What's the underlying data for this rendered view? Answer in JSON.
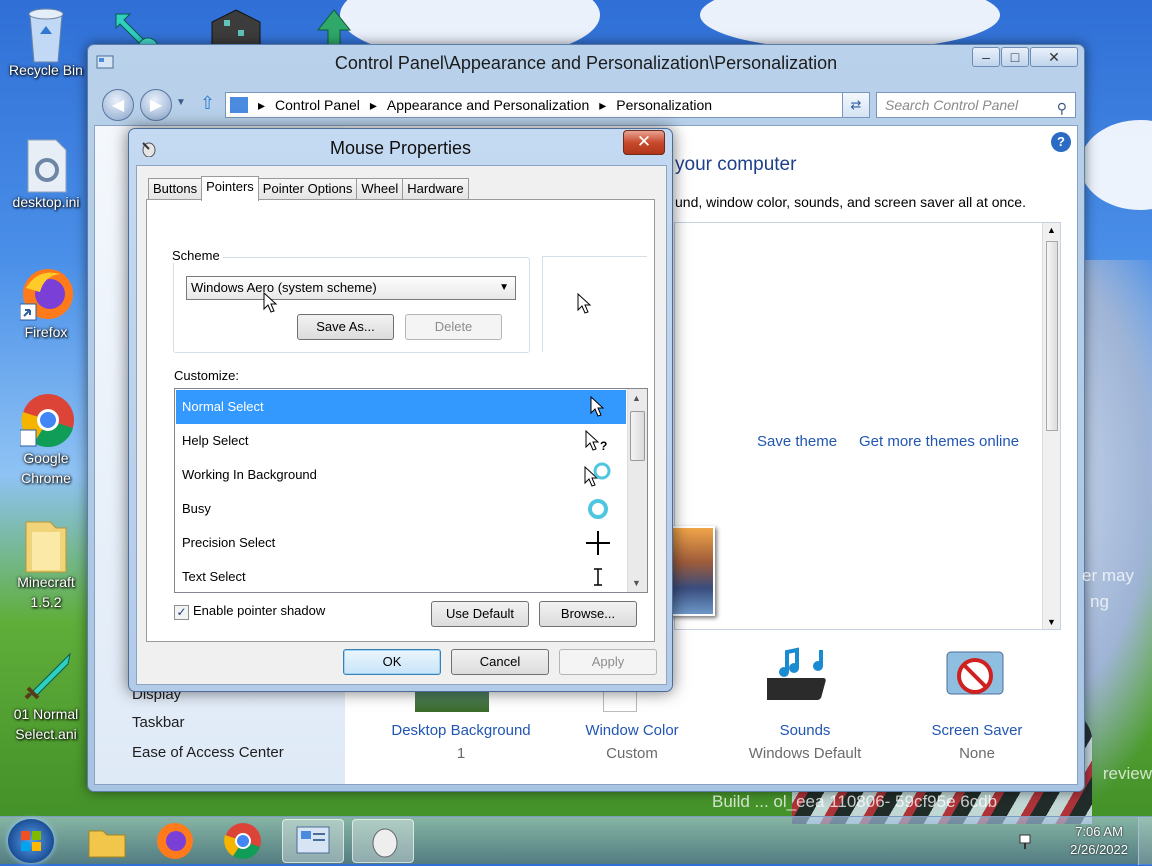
{
  "desktop": {
    "icons": [
      {
        "label": "Recycle Bin"
      },
      {
        "label": "desktop.ini"
      },
      {
        "label": "Firefox"
      },
      {
        "label": "Google Chrome"
      },
      {
        "label": "Minecraft 1.5.2"
      },
      {
        "label": "01 Normal Select.ani"
      }
    ],
    "watermark": {
      "line1": "Build ... ol_eea 110806- 59cf95e 6cdb",
      "line2": "review",
      "line3": "er may",
      "line4": "ng"
    }
  },
  "control_panel": {
    "title": "Control Panel\\Appearance and Personalization\\Personalization",
    "breadcrumb": [
      "Control Panel",
      "Appearance and Personalization",
      "Personalization"
    ],
    "search_placeholder": "Search Control Panel",
    "heading": "your computer",
    "description": "und, window color, sounds, and screen saver all at once.",
    "save_theme": "Save theme",
    "get_more_themes": "Get more themes online",
    "left_links": [
      "Display",
      "Taskbar",
      "Ease of Access Center"
    ],
    "bottom_items": [
      {
        "label": "Desktop Background",
        "value": "1"
      },
      {
        "label": "Window Color",
        "value": "Custom"
      },
      {
        "label": "Sounds",
        "value": "Windows Default"
      },
      {
        "label": "Screen Saver",
        "value": "None"
      }
    ]
  },
  "mouse_properties": {
    "title": "Mouse Properties",
    "tabs": [
      "Buttons",
      "Pointers",
      "Pointer Options",
      "Wheel",
      "Hardware"
    ],
    "active_tab": "Pointers",
    "scheme_label": "Scheme",
    "scheme_value": "Windows Aero (system scheme)",
    "save_as": "Save As...",
    "delete": "Delete",
    "customize_label": "Customize:",
    "cursor_list": [
      {
        "label": "Normal Select",
        "icon": "arrow-cursor-icon",
        "selected": true
      },
      {
        "label": "Help Select",
        "icon": "help-cursor-icon",
        "selected": false
      },
      {
        "label": "Working In Background",
        "icon": "working-cursor-icon",
        "selected": false
      },
      {
        "label": "Busy",
        "icon": "busy-cursor-icon",
        "selected": false
      },
      {
        "label": "Precision Select",
        "icon": "crosshair-cursor-icon",
        "selected": false
      },
      {
        "label": "Text Select",
        "icon": "text-cursor-icon",
        "selected": false
      }
    ],
    "enable_shadow_label": "Enable pointer shadow",
    "enable_shadow_checked": true,
    "use_default": "Use Default",
    "browse": "Browse...",
    "ok": "OK",
    "cancel": "Cancel",
    "apply": "Apply"
  },
  "taskbar": {
    "time": "7:06 AM",
    "date": "2/26/2022"
  },
  "colors": {
    "selection": "#3399ff",
    "link": "#2156b3"
  }
}
